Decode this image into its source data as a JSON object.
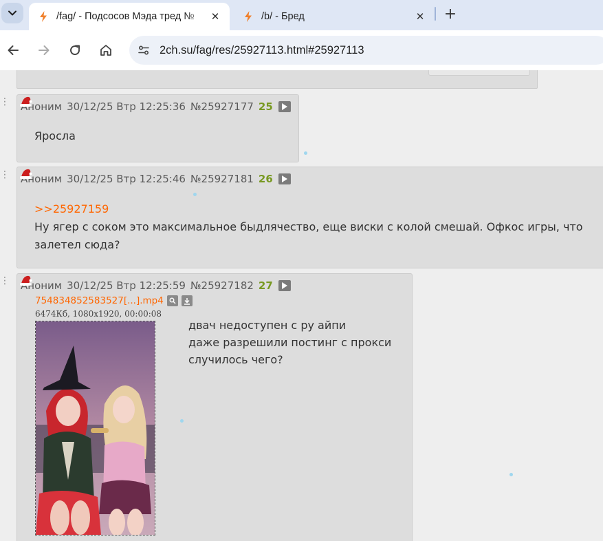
{
  "browser": {
    "tabs": [
      {
        "title": "/fag/ - Подсосов Мэда тред №",
        "active": true
      },
      {
        "title": "/b/ - Бред",
        "active": false
      }
    ],
    "tab_close_glyph": "✕",
    "new_tab_glyph": "+",
    "url": "2ch.su/fag/res/25927113.html#25927113",
    "icons": [
      "tab-list-icon",
      "favicon-lightning-icon",
      "back-icon",
      "forward-icon",
      "reload-icon",
      "home-icon",
      "site-info-icon"
    ],
    "accent_color": "#f0802c"
  },
  "posts": [
    {
      "dots": "⋮",
      "author": "Аноним",
      "date": "30/12/25 Втр 12:25:36",
      "number": "№25927177",
      "count": "25",
      "lines": [
        "Яросла"
      ]
    },
    {
      "dots": "⋮",
      "author": "Аноним",
      "date": "30/12/25 Втр 12:25:46",
      "number": "№25927181",
      "count": "26",
      "reply": ">>25927159",
      "lines": [
        "Ну ягер с соком это максимальное быдлячество, еще виски с колой смешай. Офкос игры, что",
        "залетел сюда?"
      ]
    },
    {
      "dots": "⋮",
      "author": "Аноним",
      "date": "30/12/25 Втр 12:25:59",
      "number": "№25927182",
      "count": "27",
      "file": {
        "name": "75483485258352​7[...].mp4",
        "meta": "6474Кб, 1080x1920, 00:00:08"
      },
      "lines": [
        "двач недоступен с ру айпи",
        "даже разрешили постинг с прокси",
        "случилось чего?"
      ]
    }
  ],
  "colors": {
    "post_bg": "#dddddd",
    "page_bg": "#eeeeee",
    "link": "#ff6600",
    "count": "#789922"
  }
}
